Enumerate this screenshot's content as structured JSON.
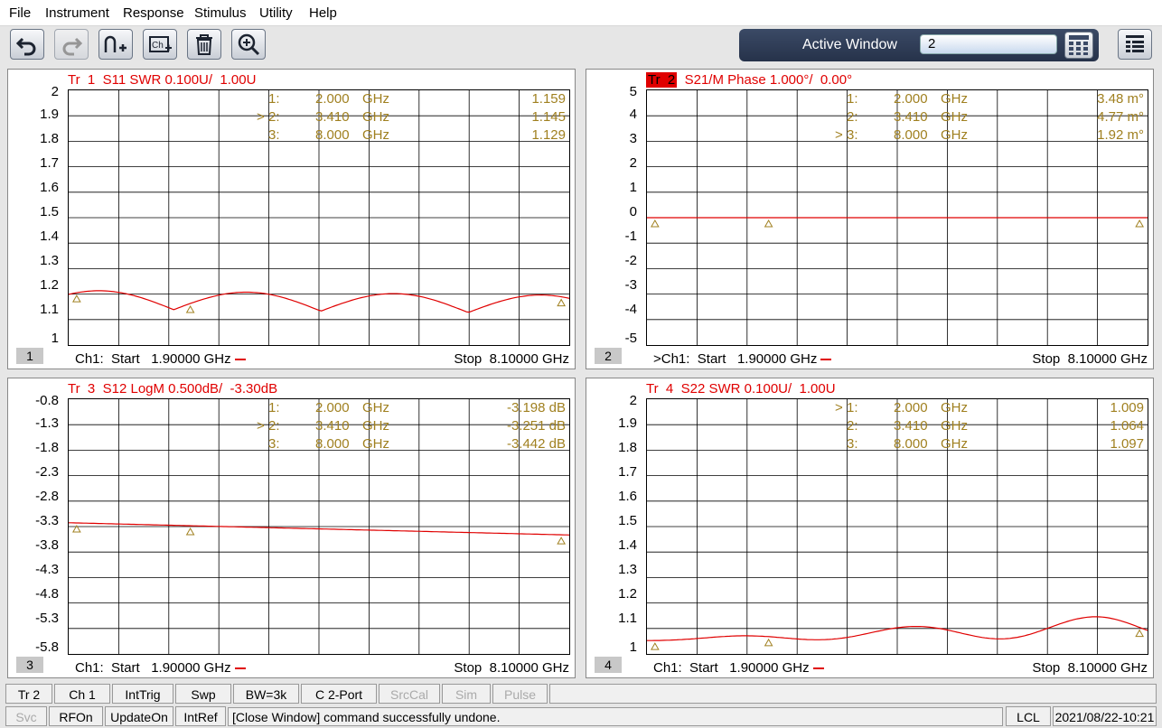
{
  "menu": [
    "File",
    "Instrument",
    "Response",
    "Stimulus",
    "Utility",
    "Help"
  ],
  "active_window": {
    "label": "Active Window",
    "value": "2"
  },
  "panels": [
    {
      "title_tr": "Tr  1",
      "title_rest": "  S11 SWR 0.100U/  1.00U",
      "active": false,
      "ylabels": [
        "2",
        "1.9",
        "1.8",
        "1.7",
        "1.6",
        "1.5",
        "1.4",
        "1.3",
        "1.2",
        "1.1",
        "1"
      ],
      "markers": [
        {
          "sel": "",
          "num": "1:",
          "freq": "2.000",
          "unit": "GHz",
          "val": "1.159"
        },
        {
          "sel": ">",
          "num": "2:",
          "freq": "3.410",
          "unit": "GHz",
          "val": "1.145"
        },
        {
          "sel": "",
          "num": "3:",
          "freq": "8.000",
          "unit": "GHz",
          "val": "1.129"
        }
      ],
      "footer_left": "Ch1:  Start   1.90000 GHz",
      "footer_right": "Stop  8.10000 GHz",
      "channel": "1"
    },
    {
      "title_tr": "Tr  2",
      "title_rest": "  S21/M Phase 1.000°/  0.00°",
      "active": true,
      "ylabels": [
        "5",
        "4",
        "3",
        "2",
        "1",
        "0",
        "-1",
        "-2",
        "-3",
        "-4",
        "-5"
      ],
      "markers": [
        {
          "sel": "",
          "num": "1:",
          "freq": "2.000",
          "unit": "GHz",
          "val": "3.48 m°"
        },
        {
          "sel": "",
          "num": "2:",
          "freq": "3.410",
          "unit": "GHz",
          "val": "4.77 m°"
        },
        {
          "sel": ">",
          "num": "3:",
          "freq": "8.000",
          "unit": "GHz",
          "val": "1.92 m°"
        }
      ],
      "footer_left": ">Ch1:  Start   1.90000 GHz",
      "footer_right": "Stop  8.10000 GHz",
      "channel": "2"
    },
    {
      "title_tr": "Tr  3",
      "title_rest": "  S12 LogM 0.500dB/  -3.30dB",
      "active": false,
      "ylabels": [
        "-0.8",
        "-1.3",
        "-1.8",
        "-2.3",
        "-2.8",
        "-3.3",
        "-3.8",
        "-4.3",
        "-4.8",
        "-5.3",
        "-5.8"
      ],
      "markers": [
        {
          "sel": "",
          "num": "1:",
          "freq": "2.000",
          "unit": "GHz",
          "val": "-3.198 dB"
        },
        {
          "sel": ">",
          "num": "2:",
          "freq": "3.410",
          "unit": "GHz",
          "val": "-3.251 dB"
        },
        {
          "sel": "",
          "num": "3:",
          "freq": "8.000",
          "unit": "GHz",
          "val": "-3.442 dB"
        }
      ],
      "footer_left": "Ch1:  Start   1.90000 GHz",
      "footer_right": "Stop  8.10000 GHz",
      "channel": "3"
    },
    {
      "title_tr": "Tr  4",
      "title_rest": "  S22 SWR 0.100U/  1.00U",
      "active": false,
      "ylabels": [
        "2",
        "1.9",
        "1.8",
        "1.7",
        "1.6",
        "1.5",
        "1.4",
        "1.3",
        "1.2",
        "1.1",
        "1"
      ],
      "markers": [
        {
          "sel": ">",
          "num": "1:",
          "freq": "2.000",
          "unit": "GHz",
          "val": "1.009"
        },
        {
          "sel": "",
          "num": "2:",
          "freq": "3.410",
          "unit": "GHz",
          "val": "1.064"
        },
        {
          "sel": "",
          "num": "3:",
          "freq": "8.000",
          "unit": "GHz",
          "val": "1.097"
        }
      ],
      "footer_left": "Ch1:  Start   1.90000 GHz",
      "footer_right": "Stop  8.10000 GHz",
      "channel": "4"
    }
  ],
  "statusbar_top": [
    "Tr 2",
    "Ch 1",
    "IntTrig",
    "Swp",
    "BW=3k",
    "C  2-Port",
    "SrcCal",
    "Sim",
    "Pulse"
  ],
  "statusbar_top_disabled": [
    false,
    false,
    false,
    false,
    false,
    false,
    true,
    true,
    true
  ],
  "statusbar_bottom": {
    "svc": "Svc",
    "rfon": "RFOn",
    "updateon": "UpdateOn",
    "intref": "IntRef",
    "message": "[Close Window] command successfully undone.",
    "lcl": "LCL",
    "datetime": "2021/08/22-10:21"
  },
  "colors": {
    "trace": "#e00000",
    "marker_text": "#a08020"
  }
}
